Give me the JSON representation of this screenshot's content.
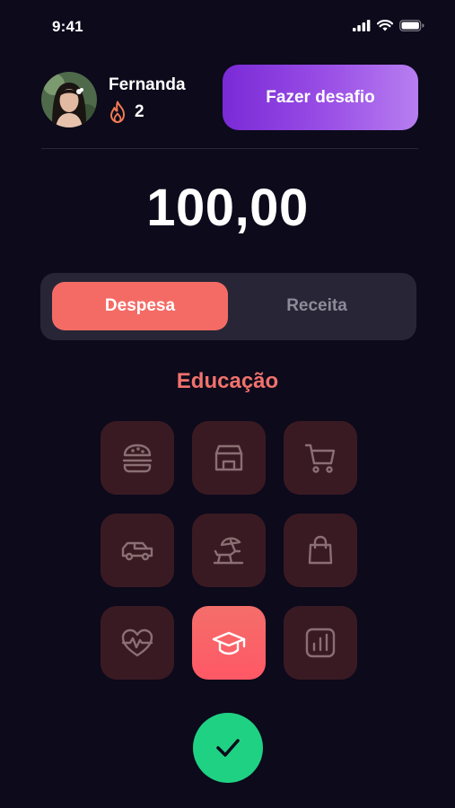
{
  "status_bar": {
    "time": "9:41",
    "icons": [
      "signal-icon",
      "wifi-icon",
      "battery-icon"
    ]
  },
  "header": {
    "user_name": "Fernanda",
    "streak_icon": "flame-icon",
    "streak_count": "2",
    "challenge_button_label": "Fazer desafio"
  },
  "amount": "100,00",
  "type_toggle": {
    "options": [
      "Despesa",
      "Receita"
    ],
    "selected": "Despesa"
  },
  "category": {
    "selected_label": "Educação",
    "icons": [
      "burger-icon",
      "store-icon",
      "cart-icon",
      "car-icon",
      "beach-icon",
      "shopping-bag-icon",
      "heart-pulse-icon",
      "graduation-cap-icon",
      "chart-icon"
    ],
    "selected_icon": "graduation-cap-icon"
  },
  "confirm_icon": "check-icon",
  "colors": {
    "background": "#0c0a1b",
    "accent": "#f46b66",
    "challenge_gradient_start": "#7a2ad6",
    "challenge_gradient_end": "#b77ef0",
    "confirm": "#1fd283",
    "tile": "#3a1a22"
  }
}
